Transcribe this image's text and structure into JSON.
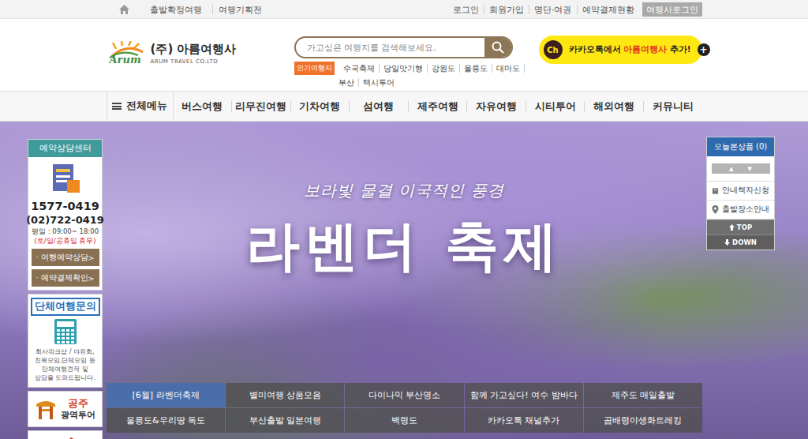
{
  "topbar": {
    "left": [
      "출발확정여행",
      "여행기획전"
    ],
    "right": [
      {
        "label": "로그인",
        "kind": "link"
      },
      {
        "label": "회원가입",
        "kind": "link"
      },
      {
        "label": "명단·여권",
        "kind": "link"
      },
      {
        "label": "예약결제현황",
        "kind": "link"
      },
      {
        "label": "여행사로그인",
        "kind": "button"
      }
    ]
  },
  "logo": {
    "mark": "Arum",
    "name": "(주) 아름여행사",
    "english": "ARUM TRAVEL CO.LTD"
  },
  "search": {
    "placeholder": "가고싶은 여행지를 검색해보세요."
  },
  "popular": {
    "label": "인기여행지",
    "rows": [
      [
        "수국축제",
        "당일맛기행",
        "강원도",
        "울릉도",
        "대마도"
      ],
      [
        "부산",
        "택시투어"
      ]
    ]
  },
  "kakao": {
    "badge": "Ch",
    "prefix": "카카오톡에서 ",
    "brand": "아름여행사",
    "suffix": " 추가!",
    "plus": "+"
  },
  "nav": {
    "all_menu": "전체메뉴",
    "items": [
      "버스여행",
      "리무진여행",
      "기차여행",
      "섬여행",
      "제주여행",
      "자유여행",
      "시티투어",
      "해외여행",
      "커뮤니티"
    ]
  },
  "banner": {
    "subtitle": "보라빛 물결 이국적인 풍경",
    "title": "라벤더 축제"
  },
  "consult": {
    "title": "예약상담센터",
    "phone": "1577-0419",
    "phone2": "(02)722-0419",
    "hours": "평일 : 09:00~ 18:00",
    "closed": "(토/일/공휴일 휴무)",
    "buttons": [
      {
        "label": "· 여행예약상담",
        "arrow": ">"
      },
      {
        "label": "· 예약결제확인",
        "arrow": ">"
      }
    ]
  },
  "group": {
    "title": "단체여행문의",
    "text": "회사워크샵 / 야유회, 친목모임,단체모임 등 단체여행견적 및 상담을 도와드립니다."
  },
  "promo": {
    "line1": "공주",
    "line2": "광역투어"
  },
  "recent": {
    "title": "오늘본상품",
    "count": "(0)",
    "arrows": [
      "▲",
      "▼"
    ],
    "links": [
      "안내책자신청",
      "출발장소안내"
    ],
    "top": "TOP",
    "down": "DOWN"
  },
  "tabs": [
    {
      "label": "[6월] 라벤더축제",
      "selected": true
    },
    {
      "label": "별미여행 상품모음",
      "selected": false
    },
    {
      "label": "다이나믹 부산명소",
      "selected": false
    },
    {
      "label": "함께 가고싶다! 여수 밤바다",
      "selected": false
    },
    {
      "label": "제주도 매일출발",
      "selected": false
    },
    {
      "label": "울릉도&우리땅 독도",
      "selected": false
    },
    {
      "label": "부산출발 일본여행",
      "selected": false
    },
    {
      "label": "백령도",
      "selected": false
    },
    {
      "label": "카카오톡 채널추가",
      "selected": false
    },
    {
      "label": "곰배령야생화트레킹",
      "selected": false
    }
  ]
}
